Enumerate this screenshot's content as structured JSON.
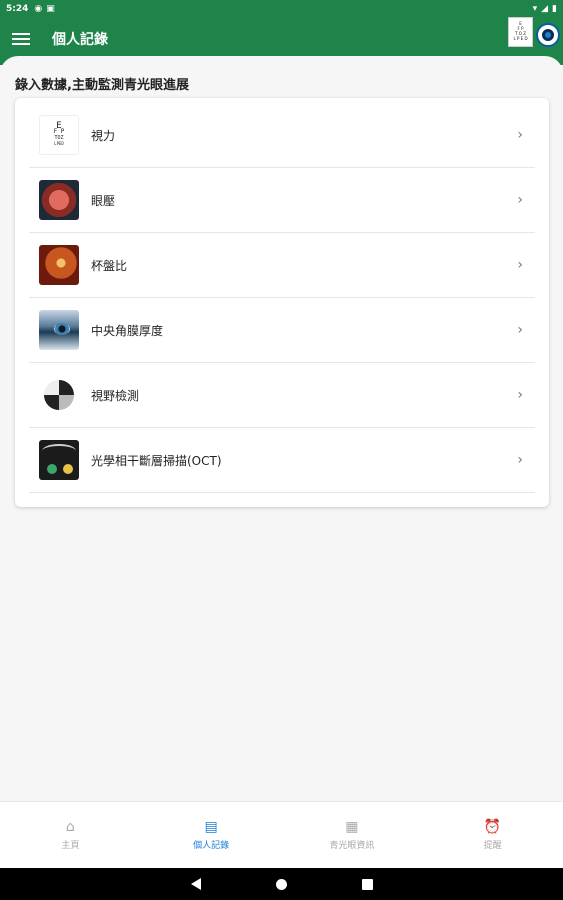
{
  "status_bar": {
    "time": "5:24",
    "icons_left": [
      "notification-icon",
      "sim-icon"
    ],
    "icons_right": [
      "wifi-icon",
      "signal-icon",
      "battery-icon"
    ]
  },
  "app_bar": {
    "title": "個人記錄",
    "eye_chart_text": "E\nFP\nTOZ\nLPED"
  },
  "page": {
    "heading": "錄入數據,主動監測青光眼進展"
  },
  "records": [
    {
      "label": "視力",
      "icon": "eye-chart-icon"
    },
    {
      "label": "眼壓",
      "icon": "eye-cross-section-icon"
    },
    {
      "label": "杯盤比",
      "icon": "optic-disc-icon"
    },
    {
      "label": "中央角膜厚度",
      "icon": "eye-closeup-icon"
    },
    {
      "label": "視野檢測",
      "icon": "visual-field-icon"
    },
    {
      "label": "光學相干斷層掃描(OCT)",
      "icon": "oct-scan-icon"
    }
  ],
  "bottom_nav": [
    {
      "label": "主頁",
      "icon": "home-icon",
      "active": false
    },
    {
      "label": "個人記錄",
      "icon": "calendar-edit-icon",
      "active": true
    },
    {
      "label": "青光眼資訊",
      "icon": "document-icon",
      "active": false
    },
    {
      "label": "提醒",
      "icon": "alarm-icon",
      "active": false
    }
  ],
  "colors": {
    "primary": "#1e8449",
    "active_nav": "#1a7fd6",
    "inactive_nav": "#aaaaaa"
  }
}
